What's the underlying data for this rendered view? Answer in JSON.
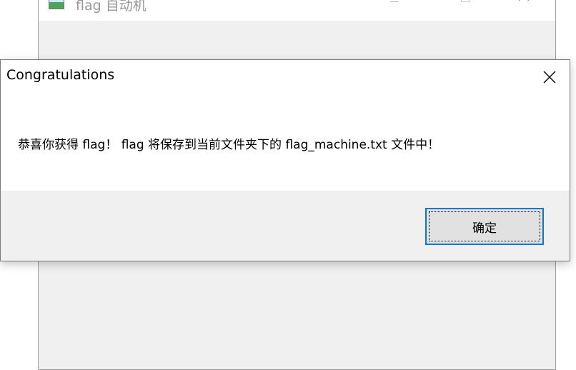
{
  "background_window": {
    "title": "flag 自动机",
    "icons": {
      "app": "app-icon",
      "minimize": "minimize-icon",
      "maximize": "maximize-icon",
      "close": "close-icon"
    }
  },
  "dialog": {
    "title": "Congratulations",
    "message": "恭喜你获得 flag！ flag 将保存到当前文件夹下的 flag_machine.txt 文件中！",
    "ok_button_label": "确定",
    "close_icon": "close-icon"
  },
  "colors": {
    "dialog_footer": "#f0f0f0",
    "dialog_body": "#ffffff",
    "button_focus_border": "#0078d7",
    "button_face": "#e1e1e1"
  }
}
